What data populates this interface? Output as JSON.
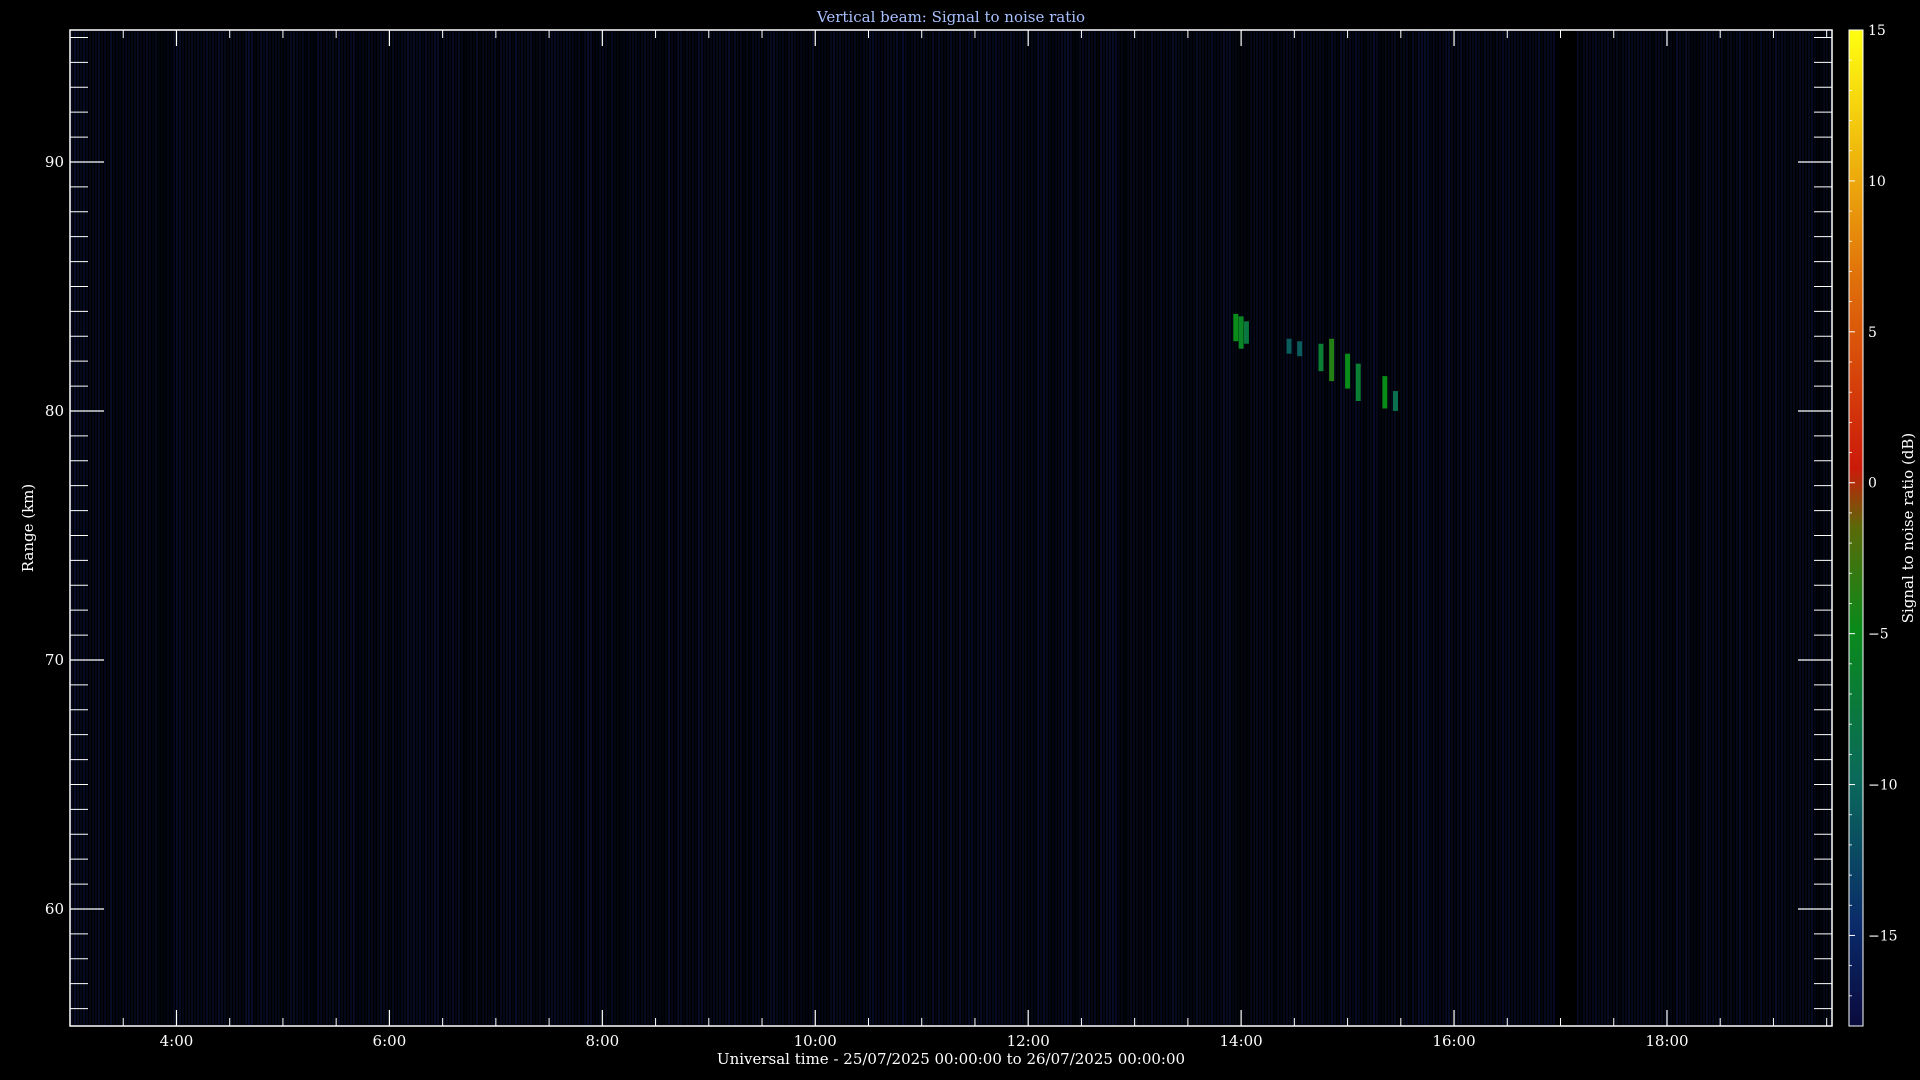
{
  "chart_data": {
    "type": "heatmap",
    "title": "Vertical beam: Signal to noise ratio",
    "xlabel": "Universal time - 25/07/2025 00:00:00 to 26/07/2025 00:00:00",
    "ylabel": "Range (km)",
    "colorbar_label": "Signal to noise ratio (dB)",
    "x_unit": "hours UT",
    "xlim": [
      3.0,
      19.55
    ],
    "ylim": [
      55.3,
      95.3
    ],
    "clim": [
      -18,
      15
    ],
    "x_ticks": [
      {
        "value": 4,
        "label": "4:00"
      },
      {
        "value": 6,
        "label": "6:00"
      },
      {
        "value": 8,
        "label": "8:00"
      },
      {
        "value": 10,
        "label": "10:00"
      },
      {
        "value": 12,
        "label": "12:00"
      },
      {
        "value": 14,
        "label": "14:00"
      },
      {
        "value": 16,
        "label": "16:00"
      },
      {
        "value": 18,
        "label": "18:00"
      }
    ],
    "y_ticks": [
      {
        "value": 60,
        "label": "60"
      },
      {
        "value": 70,
        "label": "70"
      },
      {
        "value": 80,
        "label": "80"
      },
      {
        "value": 90,
        "label": "90"
      }
    ],
    "colorbar_ticks": [
      {
        "value": -15,
        "label": "−15"
      },
      {
        "value": -10,
        "label": "−10"
      },
      {
        "value": -5,
        "label": "−5"
      },
      {
        "value": 0,
        "label": "0"
      },
      {
        "value": 5,
        "label": "5"
      },
      {
        "value": 10,
        "label": "10"
      },
      {
        "value": 15,
        "label": "15"
      }
    ],
    "background_snr": -16,
    "no_data_intervals": [
      [
        16.95,
        17.15
      ]
    ],
    "echoes": [
      {
        "time": 13.95,
        "range_start": 82.8,
        "range_end": 83.9,
        "snr": -5
      },
      {
        "time": 14.0,
        "range_start": 82.5,
        "range_end": 83.8,
        "snr": -6
      },
      {
        "time": 14.05,
        "range_start": 82.7,
        "range_end": 83.6,
        "snr": -8
      },
      {
        "time": 14.45,
        "range_start": 82.3,
        "range_end": 82.9,
        "snr": -11
      },
      {
        "time": 14.55,
        "range_start": 82.2,
        "range_end": 82.8,
        "snr": -11
      },
      {
        "time": 14.75,
        "range_start": 81.6,
        "range_end": 82.7,
        "snr": -7
      },
      {
        "time": 14.85,
        "range_start": 81.2,
        "range_end": 82.9,
        "snr": -4
      },
      {
        "time": 15.0,
        "range_start": 80.9,
        "range_end": 82.3,
        "snr": -5
      },
      {
        "time": 15.1,
        "range_start": 80.4,
        "range_end": 81.9,
        "snr": -7
      },
      {
        "time": 15.35,
        "range_start": 80.1,
        "range_end": 81.4,
        "snr": -5
      },
      {
        "time": 15.45,
        "range_start": 80.0,
        "range_end": 80.8,
        "snr": -9
      }
    ]
  }
}
